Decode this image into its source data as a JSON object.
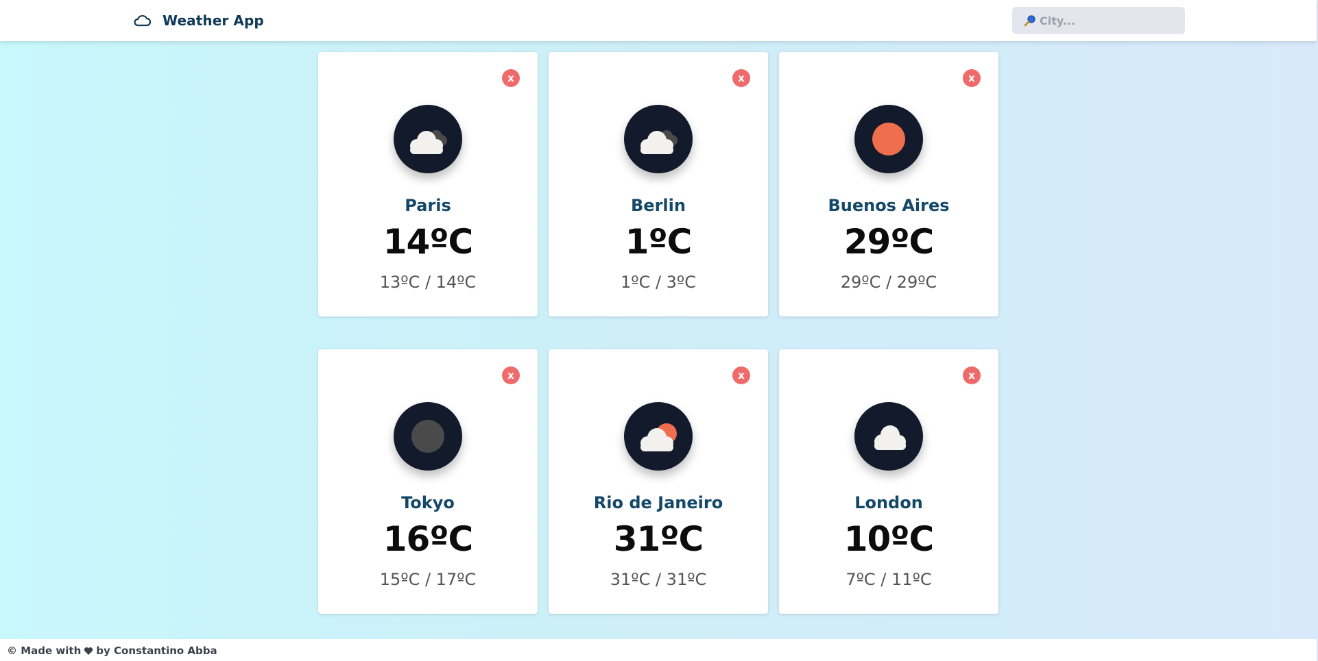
{
  "header": {
    "title": "Weather App",
    "logo_icon": "cloud-icon",
    "search": {
      "placeholder": "City...",
      "value": "",
      "icon": "search-icon"
    }
  },
  "cards": [
    {
      "city": "Paris",
      "temp": "14ºC",
      "range": "13ºC / 14ºC",
      "icon": "partly-cloudy-night-icon",
      "remove_label": "x"
    },
    {
      "city": "Berlin",
      "temp": "1ºC",
      "range": "1ºC / 3ºC",
      "icon": "partly-cloudy-night-icon",
      "remove_label": "x"
    },
    {
      "city": "Buenos Aires",
      "temp": "29ºC",
      "range": "29ºC / 29ºC",
      "icon": "sun-icon",
      "remove_label": "x"
    },
    {
      "city": "Tokyo",
      "temp": "16ºC",
      "range": "15ºC / 17ºC",
      "icon": "moon-icon",
      "remove_label": "x"
    },
    {
      "city": "Rio de Janeiro",
      "temp": "31ºC",
      "range": "31ºC / 31ºC",
      "icon": "partly-cloudy-day-icon",
      "remove_label": "x"
    },
    {
      "city": "London",
      "temp": "10ºC",
      "range": "7ºC / 11ºC",
      "icon": "cloud-icon",
      "remove_label": "x"
    }
  ],
  "footer": {
    "prefix": "© Made with",
    "suffix": "by Constantino Abba",
    "icon": "heart-icon"
  },
  "colors": {
    "brand": "#0f3a57",
    "city": "#134868",
    "remove": "#ef6b6b",
    "icon_bg": "#121a2b",
    "sun": "#ee6e4d"
  }
}
